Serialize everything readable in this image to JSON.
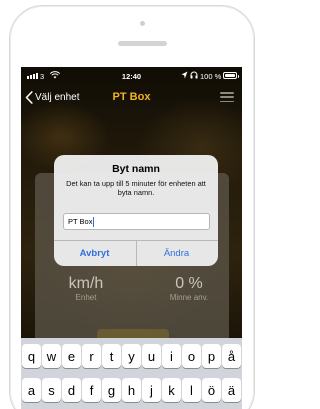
{
  "status_bar": {
    "carrier": "3",
    "time": "12:40",
    "battery": "100 %"
  },
  "nav": {
    "back_label": "Välj enhet",
    "title": "PT Box"
  },
  "stats": [
    {
      "value": "km/h",
      "label": "Enhet"
    },
    {
      "value": "0 %",
      "label": "Minne anv."
    }
  ],
  "alert": {
    "title": "Byt namn",
    "message": "Det kan ta upp till 5 minuter för enheten att byta namn.",
    "input_value": "PT Box",
    "cancel_label": "Avbryt",
    "ok_label": "Ändra"
  },
  "keyboard": {
    "row1": [
      "q",
      "w",
      "e",
      "r",
      "t",
      "y",
      "u",
      "i",
      "o",
      "p",
      "å"
    ],
    "row2": [
      "a",
      "s",
      "d",
      "f",
      "g",
      "h",
      "j",
      "k",
      "l",
      "ö",
      "ä"
    ]
  },
  "colors": {
    "accent": "#f3b31f",
    "ios_blue": "#2f6fe0"
  }
}
